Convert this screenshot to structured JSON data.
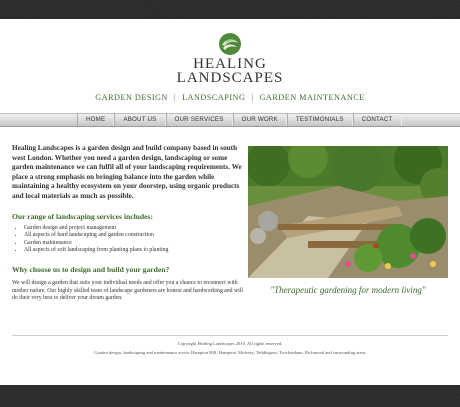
{
  "brand": {
    "line1": "HEALING",
    "line2": "LANDSCAPES"
  },
  "subnav": {
    "items": [
      "GARDEN DESIGN",
      "LANDSCAPING",
      "GARDEN MAINTENANCE"
    ],
    "separator": "|"
  },
  "menu": {
    "items": [
      "HOME",
      "ABOUT US",
      "OUR SERVICES",
      "OUR WORK",
      "TESTIMONIALS",
      "CONTACT"
    ]
  },
  "content": {
    "intro": "Healing Landscapes is a garden design and build company based in south west London. Whether you need a garden design, landscaping or some garden maintenance we can fulfil all of your landscaping requirements. We place a strong emphasis on bringing balance into the garden while maintaining a healthy ecosystem on your doorstep, using organic products and local materials as much as possible.",
    "range_heading": "Our range of landscaping services includes:",
    "services": [
      "Garden design and project management",
      "All aspects of hard landscaping and garden construction",
      "Garden maintenance",
      "All aspects of soft landscaping from planting plans to planting"
    ],
    "why_heading": "Why choose us to design and build your garden?",
    "why_text": "We will design a garden that suits your individual needs and offer you a chance to reconnect with mother nature. Our highly skilled team of landscape gardeners are honest and hardworking and will do their very best to deliver your dream garden."
  },
  "quote": "\"Therapeutic gardening for modern living\"",
  "footer": {
    "copyright": "Copyright Healing Landscapes 2010. All rights reserved.",
    "areas": "Garden design, landscaping and maintenance across Hampton Hill, Hampton, Molesey, Teddington, Twickenham, Richmond and surrounding areas"
  },
  "colors": {
    "accent_green": "#3d6b2a",
    "background_dark": "#2c2c2c",
    "page": "#ffffff"
  }
}
